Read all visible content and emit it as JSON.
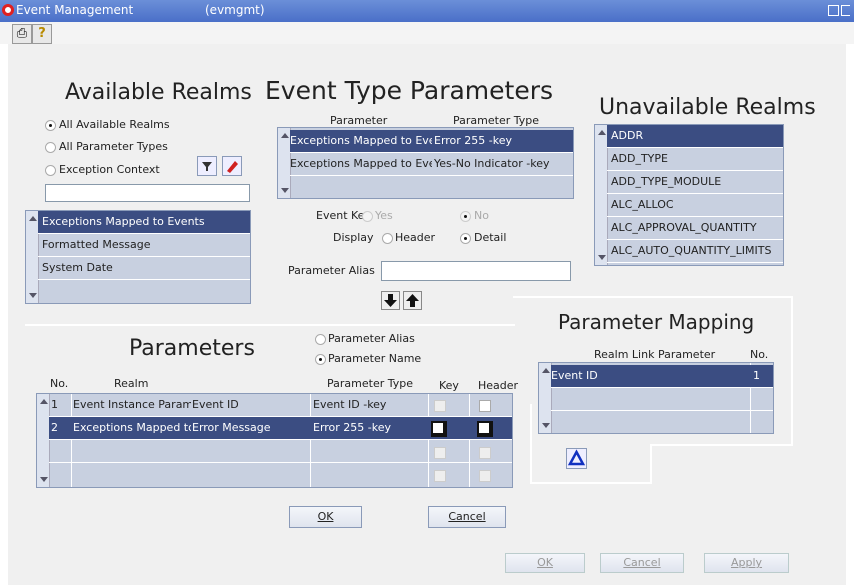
{
  "window": {
    "title": "Event Management",
    "subtitle": "(evmgmt)"
  },
  "toolbar": {
    "print_icon": "printer-icon",
    "help_icon": "help-icon"
  },
  "available_realms": {
    "title": "Available Realms",
    "radios": [
      {
        "label": "All Available Realms",
        "checked": true
      },
      {
        "label": "All Parameter Types",
        "checked": false
      },
      {
        "label": "Exception Context",
        "checked": false
      }
    ],
    "filter_value": "",
    "items": [
      "Exceptions Mapped to Events",
      "Formatted Message",
      "System Date"
    ]
  },
  "event_type_parameters": {
    "title": "Event Type Parameters",
    "col_parameter": "Parameter",
    "col_type": "Parameter Type",
    "rows": [
      {
        "parameter": "Exceptions Mapped to Eve",
        "type": "Error 255 -key"
      },
      {
        "parameter": "Exceptions Mapped to Eve",
        "type": "Yes-No Indicator -key"
      }
    ],
    "event_key_label": "Event Key",
    "event_key_yes": "Yes",
    "event_key_no": "No",
    "display_label": "Display",
    "display_header": "Header",
    "display_detail": "Detail",
    "alias_label": "Parameter Alias",
    "alias_value": ""
  },
  "unavailable_realms": {
    "title": "Unavailable Realms",
    "items": [
      "ADDR",
      "ADD_TYPE",
      "ADD_TYPE_MODULE",
      "ALC_ALLOC",
      "ALC_APPROVAL_QUANTITY",
      "ALC_AUTO_QUANTITY_LIMITS"
    ]
  },
  "parameters": {
    "title": "Parameters",
    "sort_alias": "Parameter Alias",
    "sort_name": "Parameter Name",
    "col_no": "No.",
    "col_realm": "Realm",
    "col_type": "Parameter Type",
    "col_key": "Key",
    "col_header": "Header",
    "rows": [
      {
        "no": "1",
        "realm": "Event Instance Parame",
        "param": "Event ID",
        "type": "Event ID -key"
      },
      {
        "no": "2",
        "realm": "Exceptions Mapped to",
        "param": "Error Message",
        "type": "Error 255 -key"
      }
    ]
  },
  "parameter_mapping": {
    "title": "Parameter Mapping",
    "col_realm_link": "Realm Link Parameter",
    "col_no": "No.",
    "rows": [
      {
        "param": "Event ID",
        "no": "1"
      }
    ]
  },
  "buttons": {
    "ok": "OK",
    "cancel": "Cancel"
  },
  "footer_buttons": {
    "ok": "OK",
    "cancel": "Cancel",
    "apply": "Apply"
  }
}
